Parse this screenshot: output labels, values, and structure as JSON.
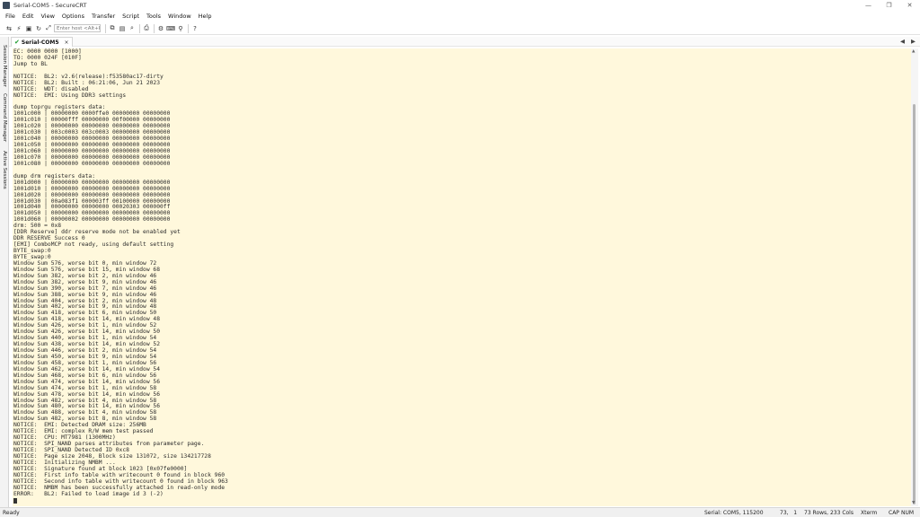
{
  "window": {
    "title": "Serial-COM5 - SecureCRT",
    "controls": [
      "—",
      "❐",
      "✕"
    ]
  },
  "menu": [
    "File",
    "Edit",
    "View",
    "Options",
    "Transfer",
    "Script",
    "Tools",
    "Window",
    "Help"
  ],
  "toolbar": {
    "host_placeholder": "Enter host <Alt+R>",
    "icons": [
      "connect-icon",
      "quick-connect-icon",
      "new-tab-icon",
      "reconnect-icon",
      "disconnect-icon",
      "copy-icon",
      "paste-icon",
      "find-icon",
      "print-icon",
      "settings-icon",
      "keymap-icon",
      "sftp-icon",
      "help-icon"
    ]
  },
  "sidebar": {
    "tabs": [
      "Session Manager",
      "Command Manager",
      "Active Sessions"
    ]
  },
  "session_tab": {
    "label": "Serial-COM5",
    "close": "×",
    "nav_left": "◀",
    "nav_right": "▶"
  },
  "terminal": {
    "lines": [
      "EC: 0000 0000 [1000]",
      "TO: 0000 024F [010F]",
      "Jump to BL",
      "",
      "NOTICE:  BL2: v2.6(release):f53580ac17-dirty",
      "NOTICE:  BL2: Built : 06:21:06, Jun 21 2023",
      "NOTICE:  WDT: disabled",
      "NOTICE:  EMI: Using DDR3 settings",
      "",
      "dump toprgu registers data:",
      "1001c000 | 00000000 0000ffe0 00000000 00000000",
      "1001c010 | 00000fff 00000000 00f00000 00000000",
      "1001c020 | 00000000 00000000 00000000 00000000",
      "1001c030 | 003c0003 003c0003 00000000 00000000",
      "1001c040 | 00000000 00000000 00000000 00000000",
      "1001c050 | 00000000 00000000 00000000 00000000",
      "1001c060 | 00000000 00000000 00000000 00000000",
      "1001c070 | 00000000 00000000 00000000 00000000",
      "1001c080 | 00000000 00000000 00000000 00000000",
      "",
      "dump drm registers data:",
      "1001d000 | 00000000 00000000 00000000 00000000",
      "1001d010 | 00000000 00000000 00000000 00000000",
      "1001d020 | 00000000 00000000 00000000 00000000",
      "1001d030 | 00a083f1 000003ff 00100000 00000000",
      "1001d040 | 00000000 00000000 00020303 000000ff",
      "1001d050 | 00000000 00000000 00000000 00000000",
      "1001d060 | 00000002 00000000 00000000 00000000",
      "drm: 500 = 0x8",
      "[DDR Reserve] ddr reserve mode not be enabled yet",
      "DDR RESERVE Success 0",
      "[EMI] ComboMCP not ready, using default setting",
      "BYTE_swap:0",
      "BYTE_swap:0",
      "Window Sum 576, worse bit 0, min window 72",
      "Window Sum 576, worse bit 15, min window 68",
      "Window Sum 382, worse bit 2, min window 46",
      "Window Sum 382, worse bit 9, min window 46",
      "Window Sum 390, worse bit 7, min window 46",
      "Window Sum 388, worse bit 9, min window 46",
      "Window Sum 404, worse bit 2, min window 48",
      "Window Sum 402, worse bit 9, min window 48",
      "Window Sum 418, worse bit 6, min window 50",
      "Window Sum 418, worse bit 14, min window 48",
      "Window Sum 426, worse bit 1, min window 52",
      "Window Sum 426, worse bit 14, min window 50",
      "Window Sum 440, worse bit 1, min window 54",
      "Window Sum 438, worse bit 14, min window 52",
      "Window Sum 446, worse bit 2, min window 54",
      "Window Sum 450, worse bit 9, min window 54",
      "Window Sum 458, worse bit 1, min window 56",
      "Window Sum 462, worse bit 14, min window 54",
      "Window Sum 468, worse bit 6, min window 56",
      "Window Sum 474, worse bit 14, min window 56",
      "Window Sum 474, worse bit 1, min window 58",
      "Window Sum 478, worse bit 14, min window 56",
      "Window Sum 482, worse bit 4, min window 58",
      "Window Sum 480, worse bit 14, min window 56",
      "Window Sum 488, worse bit 4, min window 58",
      "Window Sum 482, worse bit 8, min window 58",
      "NOTICE:  EMI: Detected DRAM size: 256MB",
      "NOTICE:  EMI: complex R/W mem test passed",
      "NOTICE:  CPU: MT7981 (1300MHz)",
      "NOTICE:  SPI_NAND parses attributes from parameter page.",
      "NOTICE:  SPI_NAND Detected ID 0xc8",
      "NOTICE:  Page size 2048, Block size 131072, size 134217728",
      "NOTICE:  Initializing NMBM ...",
      "NOTICE:  Signature found at block 1023 [0x07fe0000]",
      "NOTICE:  First info table with writecount 0 found in block 960",
      "NOTICE:  Second info table with writecount 0 found in block 963",
      "NOTICE:  NMBM has been successfully attached in read-only mode",
      "ERROR:   BL2: Failed to load image id 3 (-2)"
    ]
  },
  "status": {
    "ready": "Ready",
    "connection": "Serial: COM5, 115200",
    "position": "73,   1",
    "size": "73 Rows, 233 Cols",
    "term": "Xterm",
    "caps": "CAP",
    "num": "NUM"
  }
}
